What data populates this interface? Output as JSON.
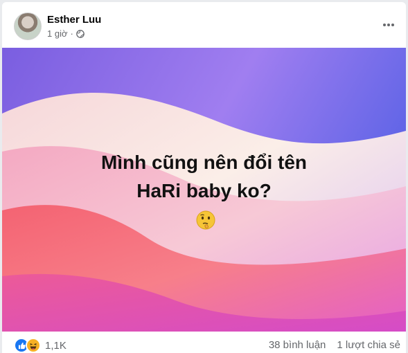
{
  "post": {
    "author": "Esther Luu",
    "time": "1 giờ",
    "privacy_icon": "globe-icon",
    "more_icon": "more-options-icon"
  },
  "image": {
    "caption_line1": "Mình cũng nên đổi tên",
    "caption_line2": "HaRi baby ko?",
    "emoji": "thinking-face-emoji",
    "colors": {
      "purple": "#6f59d9",
      "pink": "#f29dbd",
      "coral": "#f56f71",
      "cream": "#f8e9de"
    }
  },
  "footer": {
    "reaction_icons": [
      "like-icon",
      "haha-icon"
    ],
    "reaction_count": "1,1K",
    "comments": "38 bình luận",
    "shares": "1 lượt chia sẻ"
  }
}
